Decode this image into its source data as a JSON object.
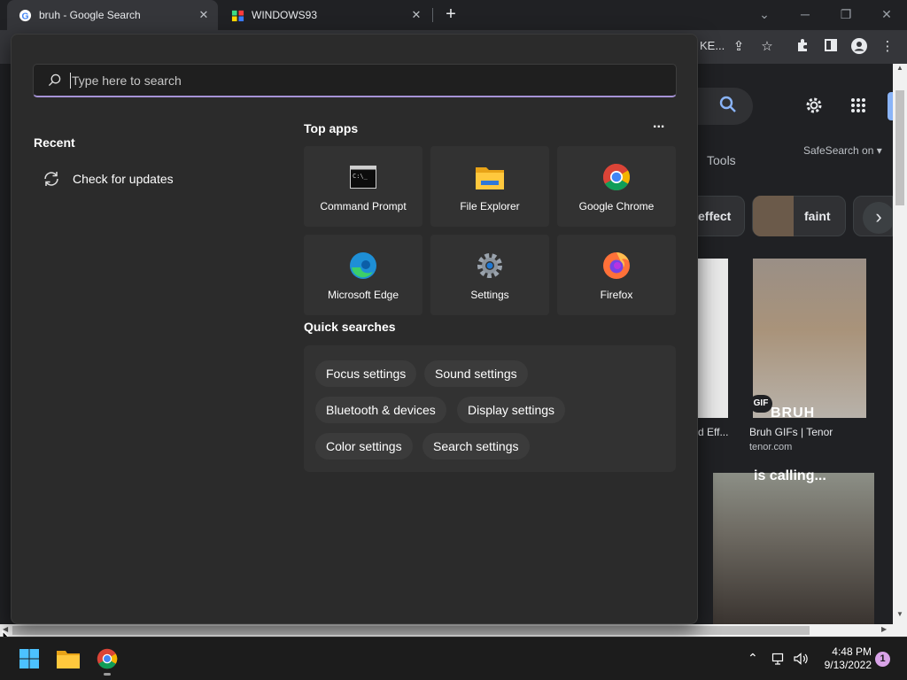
{
  "browser": {
    "tabs": [
      {
        "title": "bruh - Google Search",
        "active": true
      },
      {
        "title": "WINDOWS93",
        "active": false
      }
    ],
    "omnibox_fragment": "KE..."
  },
  "page": {
    "tools_label": "Tools",
    "safesearch_label": "SafeSearch on",
    "chips": [
      {
        "label": "effect"
      },
      {
        "label": "faint"
      }
    ],
    "results": [
      {
        "caption": "d Eff..."
      },
      {
        "caption": "Bruh GIFs | Tenor",
        "source": "tenor.com",
        "badge": "GIF",
        "overlay": "BRUH"
      },
      {
        "overlay": "is calling..."
      }
    ]
  },
  "start_menu": {
    "search_placeholder": "Type here to search",
    "recent": {
      "title": "Recent",
      "items": [
        {
          "label": "Check for updates",
          "icon": "refresh-icon"
        }
      ]
    },
    "top_apps": {
      "title": "Top apps",
      "more": "...",
      "apps": [
        {
          "label": "Command Prompt",
          "icon": "command-prompt-icon"
        },
        {
          "label": "File Explorer",
          "icon": "folder-icon"
        },
        {
          "label": "Google Chrome",
          "icon": "chrome-icon"
        },
        {
          "label": "Microsoft Edge",
          "icon": "edge-icon"
        },
        {
          "label": "Settings",
          "icon": "gear-icon"
        },
        {
          "label": "Firefox",
          "icon": "firefox-icon"
        }
      ]
    },
    "quick_searches": {
      "title": "Quick searches",
      "items": [
        "Focus settings",
        "Sound settings",
        "Bluetooth & devices",
        "Display settings",
        "Color settings",
        "Search settings"
      ]
    }
  },
  "taskbar": {
    "time": "4:48 PM",
    "date": "9/13/2022",
    "notification_count": "1"
  }
}
